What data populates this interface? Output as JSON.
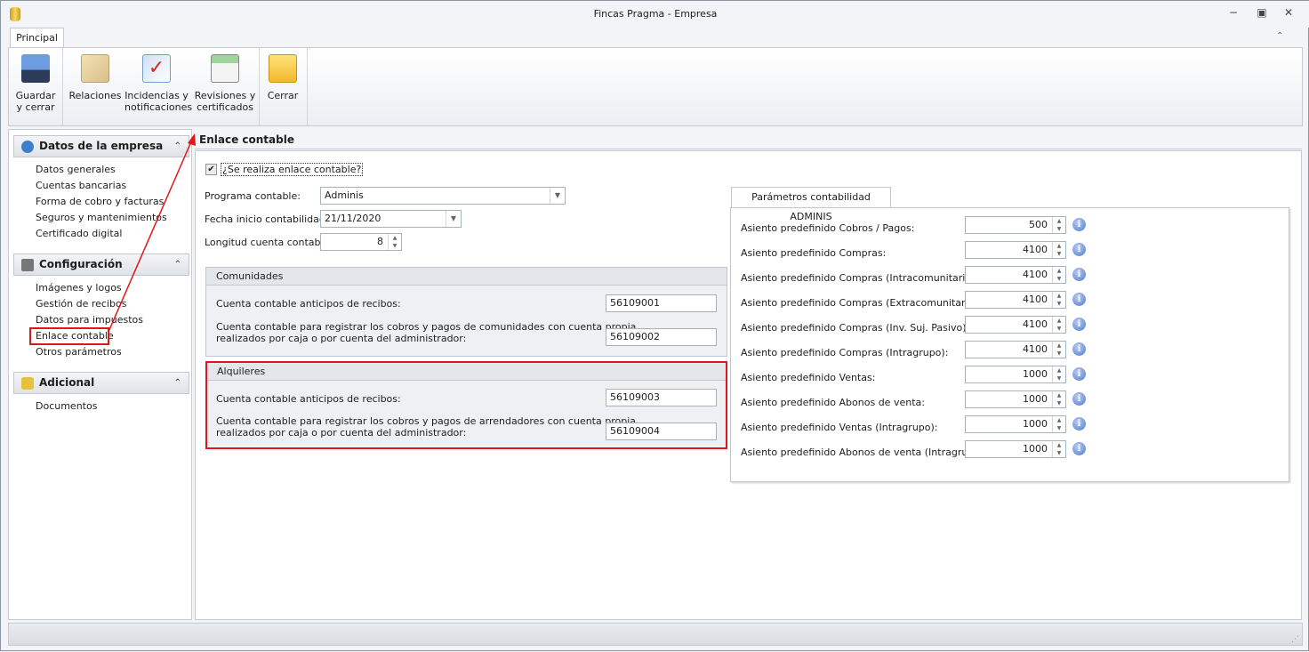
{
  "window": {
    "title": "Fincas Pragma - Empresa",
    "minimize": "−",
    "restore": "▣",
    "close": "✕",
    "collapse_ribbon": "⌃"
  },
  "ribbon": {
    "tab": "Principal",
    "buttons": [
      {
        "label1": "Guardar",
        "label2": "y cerrar",
        "icon": "save-icon"
      },
      {
        "label1": "Relaciones",
        "label2": "",
        "icon": "contacts-icon"
      },
      {
        "label1": "Incidencias y",
        "label2": "notificaciones",
        "icon": "incidents-icon"
      },
      {
        "label1": "Revisiones y",
        "label2": "certificados",
        "icon": "reviews-icon"
      },
      {
        "label1": "Cerrar",
        "label2": "",
        "icon": "close-folder-icon"
      }
    ]
  },
  "sidebar": {
    "groups": [
      {
        "title": "Datos de la empresa",
        "items": [
          "Datos generales",
          "Cuentas bancarias",
          "Forma de cobro y facturas",
          "Seguros y mantenimientos",
          "Certificado digital"
        ]
      },
      {
        "title": "Configuración",
        "items": [
          "Imágenes y logos",
          "Gestión de recibos",
          "Datos para impuestos",
          "Enlace contable",
          "Otros parámetros"
        ]
      },
      {
        "title": "Adicional",
        "items": [
          "Documentos"
        ]
      }
    ],
    "selected": "Enlace contable"
  },
  "main": {
    "title": "Enlace contable",
    "checkbox_label": "¿Se realiza enlace contable?",
    "checkbox_checked": true,
    "programa_label": "Programa contable:",
    "programa_value": "Adminis",
    "fecha_label": "Fecha inicio contabilidad:",
    "fecha_value": "21/11/2020",
    "longitud_label": "Longitud cuenta contable:",
    "longitud_value": "8",
    "comunidades": {
      "title": "Comunidades",
      "row1_label": "Cuenta contable anticipos de recibos:",
      "row1_value": "56109001",
      "row2_label1": "Cuenta contable para registrar los cobros y pagos de comunidades con cuenta propia",
      "row2_label2": "realizados por caja o por cuenta del administrador:",
      "row2_value": "56109002"
    },
    "alquileres": {
      "title": "Alquileres",
      "row1_label": "Cuenta contable anticipos de recibos:",
      "row1_value": "56109003",
      "row2_label1": "Cuenta contable para registrar los cobros y pagos de arrendadores con cuenta propia",
      "row2_label2": "realizados por caja o por cuenta del administrador:",
      "row2_value": "56109004"
    },
    "params": {
      "tab": "Parámetros contabilidad ADMINIS",
      "rows": [
        {
          "label": "Asiento  predefinido Cobros / Pagos:",
          "value": "500"
        },
        {
          "label": "Asiento  predefinido Compras:",
          "value": "4100"
        },
        {
          "label": "Asiento  predefinido Compras (Intracomunitarias):",
          "value": "4100"
        },
        {
          "label": "Asiento  predefinido Compras (Extracomunitarias):",
          "value": "4100"
        },
        {
          "label": "Asiento  predefinido Compras (Inv. Suj. Pasivo):",
          "value": "4100"
        },
        {
          "label": "Asiento  predefinido Compras (Intragrupo):",
          "value": "4100"
        },
        {
          "label": "Asiento  predefinido Ventas:",
          "value": "1000"
        },
        {
          "label": "Asiento  predefinido Abonos de venta:",
          "value": "1000"
        },
        {
          "label": "Asiento  predefinido Ventas (Intragrupo):",
          "value": "1000"
        },
        {
          "label": "Asiento  predefinido Abonos de venta (Intragrupo):",
          "value": "1000"
        }
      ]
    }
  },
  "colors": {
    "highlight": "#e0161c",
    "accent": "#4e78c9"
  }
}
